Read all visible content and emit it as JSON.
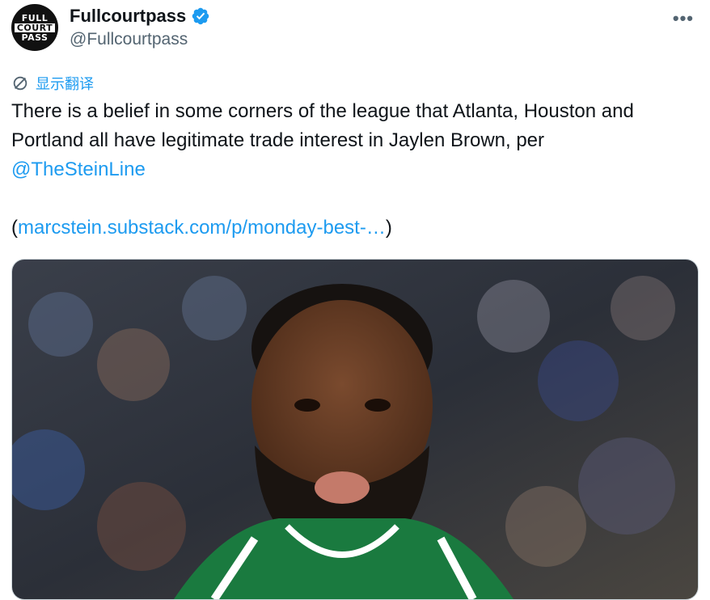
{
  "author": {
    "display_name": "Fullcourtpass",
    "handle": "@Fullcourtpass",
    "avatar_lines": [
      "FULL",
      "COURT",
      "PASS"
    ],
    "verified": true
  },
  "more_icon": "more-horizontal-icon",
  "translate_label": "显示翻译",
  "tweet": {
    "text_main": "There is a belief in some corners of the league that Atlanta, Houston and Portland all have legitimate trade interest in Jaylen Brown, per",
    "mention": "@TheSteinLine",
    "link_open": "(",
    "link_text": "marcstein.substack.com/p/monday-best-…",
    "link_close": ")"
  },
  "colors": {
    "link": "#1d9bf0",
    "secondary_text": "#536471",
    "jersey_green": "#1a7a3f"
  }
}
